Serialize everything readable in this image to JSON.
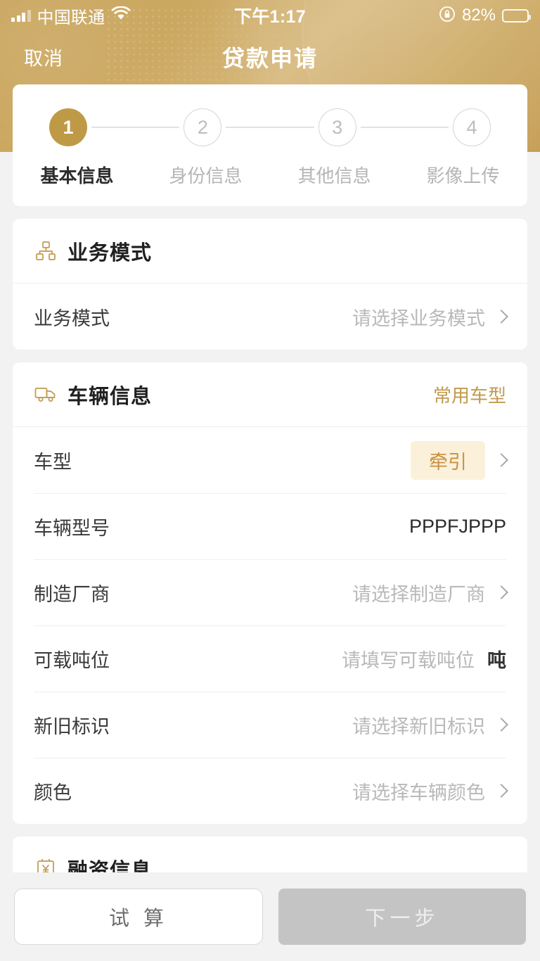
{
  "status_bar": {
    "carrier": "中国联通",
    "time": "下午1:17",
    "battery_percent": "82%",
    "signal_icon": "signal-bars-icon",
    "wifi_icon": "wifi-icon",
    "rotation_lock_icon": "rotation-lock-icon",
    "battery_icon": "battery-icon"
  },
  "navbar": {
    "cancel_label": "取消",
    "title": "贷款申请"
  },
  "stepper": {
    "steps": [
      {
        "number": "1",
        "label": "基本信息",
        "active": true
      },
      {
        "number": "2",
        "label": "身份信息",
        "active": false
      },
      {
        "number": "3",
        "label": "其他信息",
        "active": false
      },
      {
        "number": "4",
        "label": "影像上传",
        "active": false
      }
    ]
  },
  "sections": [
    {
      "key": "business_mode",
      "title": "业务模式",
      "icon": "hierarchy-icon",
      "action": null,
      "rows": [
        {
          "label": "业务模式",
          "placeholder": "请选择业务模式",
          "value": "",
          "chevron": true,
          "type": "select"
        }
      ]
    },
    {
      "key": "vehicle_info",
      "title": "车辆信息",
      "icon": "truck-icon",
      "action": "常用车型",
      "rows": [
        {
          "label": "车型",
          "placeholder": "",
          "value": "牵引",
          "badge": true,
          "chevron": true,
          "type": "select"
        },
        {
          "label": "车辆型号",
          "placeholder": "",
          "value": "PPPFJPPP",
          "chevron": false,
          "type": "text"
        },
        {
          "label": "制造厂商",
          "placeholder": "请选择制造厂商",
          "value": "",
          "chevron": true,
          "type": "select"
        },
        {
          "label": "可载吨位",
          "placeholder": "请填写可载吨位",
          "value": "",
          "unit": "吨",
          "chevron": false,
          "type": "input"
        },
        {
          "label": "新旧标识",
          "placeholder": "请选择新旧标识",
          "value": "",
          "chevron": true,
          "type": "select"
        },
        {
          "label": "颜色",
          "placeholder": "请选择车辆颜色",
          "value": "",
          "chevron": true,
          "type": "select"
        }
      ]
    },
    {
      "key": "financing_info",
      "title": "融资信息",
      "icon": "yen-clipboard-icon",
      "action": null,
      "rows": []
    }
  ],
  "bottom_bar": {
    "calc_label": "试 算",
    "next_label": "下一步"
  },
  "colors": {
    "gold": "#C09A4E",
    "gold_dark": "#BF9A46",
    "badge_bg": "#FBF1DB",
    "badge_text": "#C9913F",
    "disabled_bg": "#C4C4C4"
  }
}
